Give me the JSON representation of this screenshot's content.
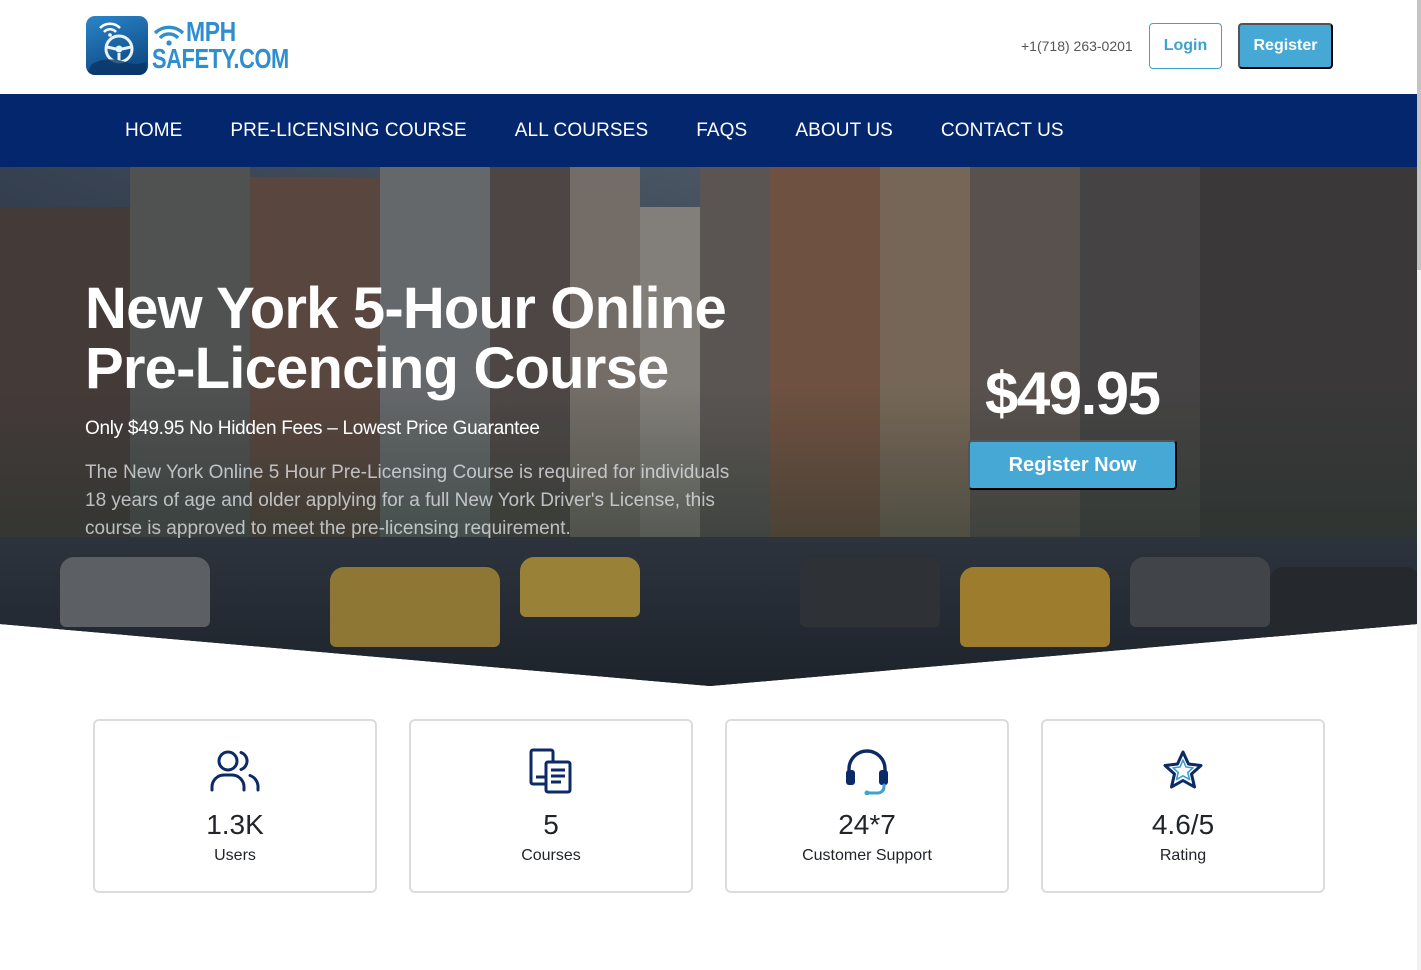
{
  "brand": {
    "logo_line1": "MPH",
    "logo_line2": "SAFETY.COM",
    "logo_icon": "steering-wheel-wifi-icon",
    "color": "#2f8ed0"
  },
  "header": {
    "phone": "+1(718) 263-0201",
    "login_label": "Login",
    "register_label": "Register"
  },
  "nav": {
    "items": [
      {
        "label": "HOME"
      },
      {
        "label": "PRE-LICENSING COURSE"
      },
      {
        "label": "ALL COURSES"
      },
      {
        "label": "FAQS"
      },
      {
        "label": "ABOUT US"
      },
      {
        "label": "CONTACT US"
      }
    ],
    "background": "#03266c"
  },
  "hero": {
    "title": "New York 5-Hour Online Pre-Licencing Course",
    "subtitle": "Only $49.95 No Hidden Fees – Lowest Price Guarantee",
    "description": "The New York Online 5 Hour Pre-Licensing Course is required for individuals 18 years of age and older applying for a full New York Driver's License, this course is approved to meet the pre-licensing requirement.",
    "price": "$49.95",
    "cta_label": "Register Now",
    "accent": "#46a8d4"
  },
  "stats": [
    {
      "icon": "users-icon",
      "value": "1.3K",
      "label": "Users"
    },
    {
      "icon": "courses-icon",
      "value": "5",
      "label": "Courses"
    },
    {
      "icon": "headset-icon",
      "value": "24*7",
      "label": "Customer Support"
    },
    {
      "icon": "star-icon",
      "value": "4.6/5",
      "label": "Rating"
    }
  ]
}
